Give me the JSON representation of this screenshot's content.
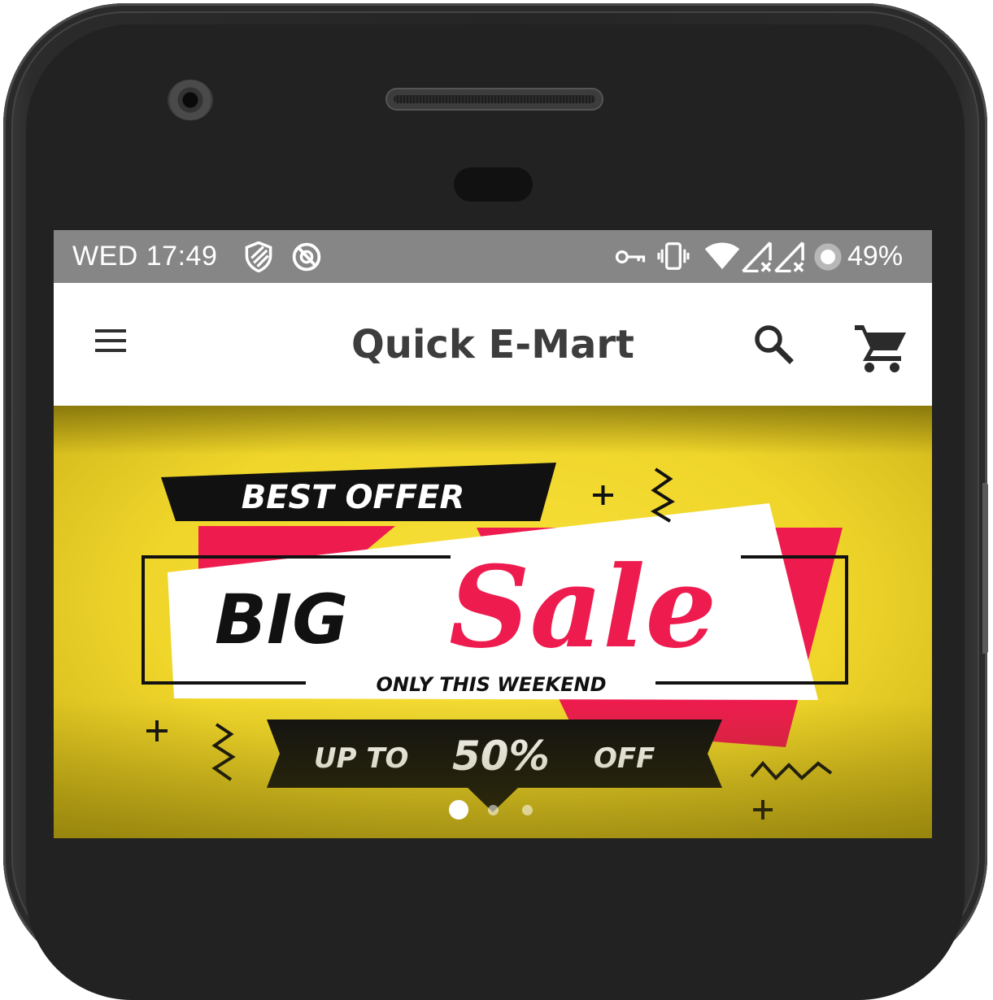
{
  "status_bar": {
    "time": "WED 17:49",
    "battery": "49%",
    "icons": [
      "shield-icon",
      "no-sync-icon",
      "vpn-key-icon",
      "vibrate-icon",
      "wifi-icon",
      "signal-no-service-icon",
      "signal-no-service-icon",
      "battery-saver-icon"
    ]
  },
  "app_bar": {
    "title": "Quick E-Mart",
    "menu_icon": "hamburger-menu-icon",
    "search_icon": "search-icon",
    "cart_icon": "shopping-cart-icon"
  },
  "banner": {
    "headline_tag": "BEST OFFER",
    "headline_big": "BIG",
    "headline_sale": "Sale",
    "subline": "ONLY THIS WEEKEND",
    "discount_prefix": "UP TO",
    "discount_value": "50%",
    "discount_suffix": "OFF",
    "slide_count": 3,
    "active_slide": 1
  },
  "colors": {
    "status_bar_bg": "#868686",
    "app_bar_bg": "#ffffff",
    "title_text": "#3d3d3d",
    "banner_yellow": "#f5db32",
    "banner_pink": "#ee1c4e",
    "banner_black": "#111111"
  }
}
